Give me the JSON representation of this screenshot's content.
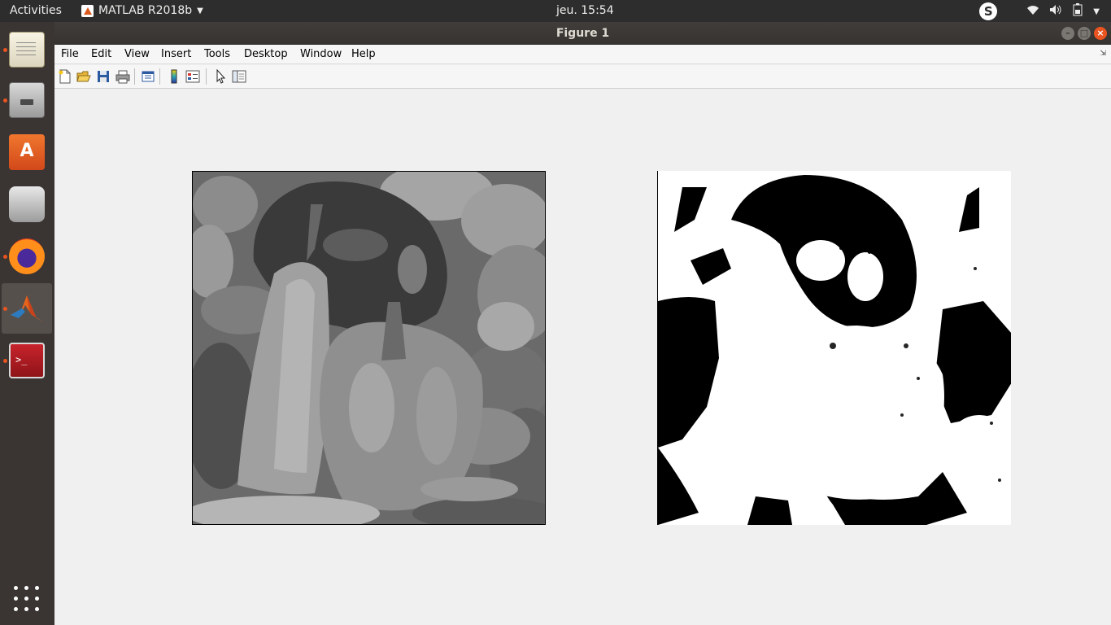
{
  "topbar": {
    "activities": "Activities",
    "app_name": "MATLAB R2018b",
    "clock": "jeu. 15:54",
    "skype_letter": "S"
  },
  "dock": {
    "items": [
      {
        "name": "text-editor-icon",
        "running": true
      },
      {
        "name": "files-icon",
        "running": true
      },
      {
        "name": "software-store-icon",
        "running": false
      },
      {
        "name": "scanner-icon",
        "running": false
      },
      {
        "name": "firefox-icon",
        "running": true
      },
      {
        "name": "matlab-icon",
        "running": true,
        "active": true
      },
      {
        "name": "terminal-icon",
        "running": true
      }
    ]
  },
  "window": {
    "title": "Figure 1",
    "menu": [
      "File",
      "Edit",
      "View",
      "Insert",
      "Tools",
      "Desktop",
      "Window",
      "Help"
    ],
    "toolbar": [
      "new-figure-icon",
      "open-file-icon",
      "save-icon",
      "print-icon",
      "link-plot-icon",
      "colorbar-icon",
      "legend-icon",
      "edit-plot-icon",
      "plot-browser-icon"
    ]
  },
  "figure": {
    "left_image": "grayscale peppers image",
    "right_image": "binarized peppers image",
    "colors": {
      "accent": "#e95420",
      "window_bg": "#f0f0f0"
    }
  }
}
